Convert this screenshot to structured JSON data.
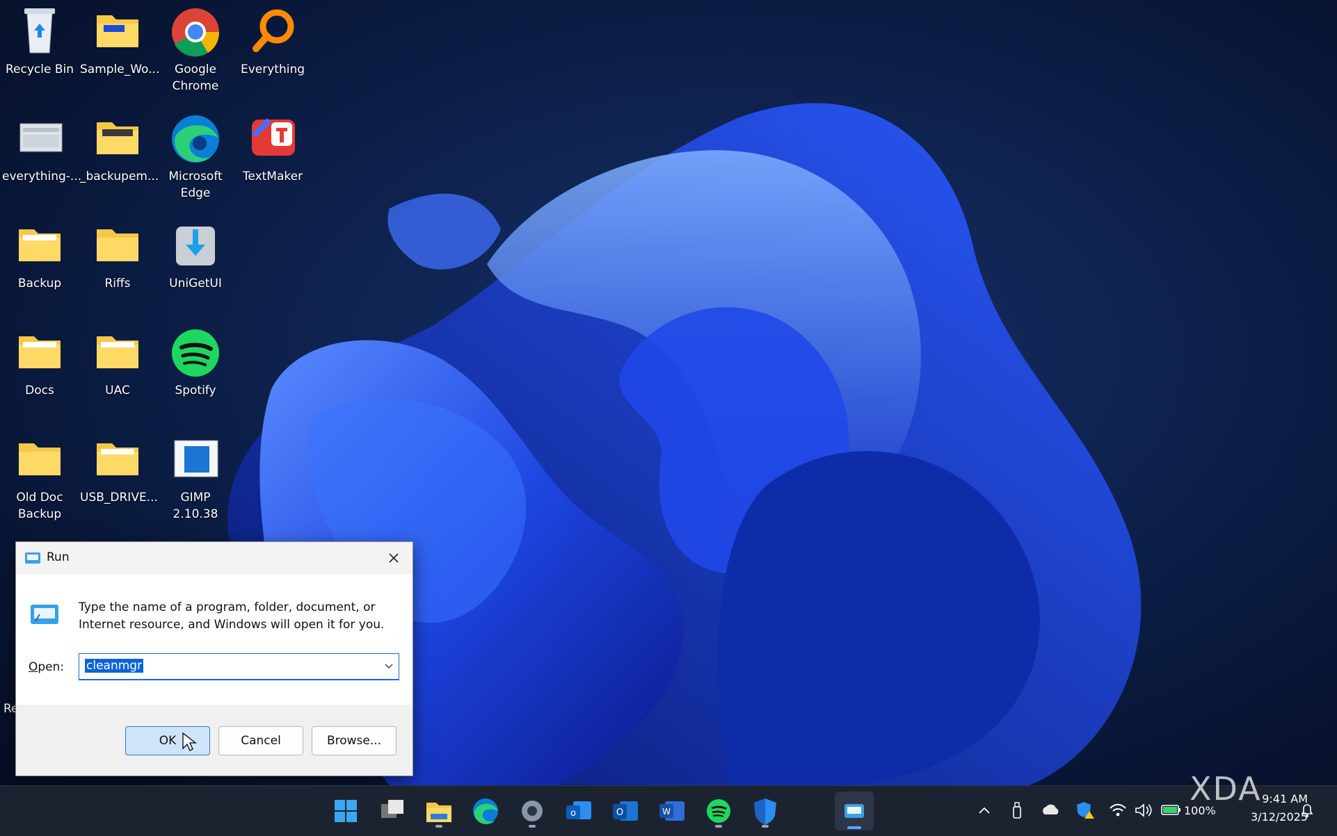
{
  "desktop": {
    "icons": [
      {
        "label": "Recycle Bin",
        "icon": "recycle-bin-icon"
      },
      {
        "label": "Sample_Wo...",
        "icon": "folder-icon"
      },
      {
        "label": "Google Chrome",
        "icon": "chrome-icon"
      },
      {
        "label": "Everything",
        "icon": "everything-search-icon"
      },
      {
        "label": "everything-...",
        "icon": "screenshot-file-icon"
      },
      {
        "label": "_backupem...",
        "icon": "folder-icon"
      },
      {
        "label": "Microsoft Edge",
        "icon": "edge-icon"
      },
      {
        "label": "TextMaker",
        "icon": "textmaker-icon"
      },
      {
        "label": "Backup",
        "icon": "folder-icon"
      },
      {
        "label": "Riffs",
        "icon": "folder-icon"
      },
      {
        "label": "UniGetUI",
        "icon": "unigetui-icon"
      },
      {
        "label": "Docs",
        "icon": "folder-icon"
      },
      {
        "label": "UAC",
        "icon": "folder-icon"
      },
      {
        "label": "Spotify",
        "icon": "spotify-icon"
      },
      {
        "label": "Old Doc Backup",
        "icon": "folder-icon"
      },
      {
        "label": "USB_DRIVE...",
        "icon": "folder-icon"
      },
      {
        "label": "GIMP 2.10.38",
        "icon": "gimp-icon"
      }
    ],
    "partial_label": "Re"
  },
  "run_dialog": {
    "title": "Run",
    "description": "Type the name of a program, folder, document, or Internet resource, and Windows will open it for you.",
    "open_label_pre": "",
    "open_label_accel": "O",
    "open_label_post": "pen:",
    "input_value": "cleanmgr",
    "ok_label": "OK",
    "cancel_label": "Cancel",
    "browse_label": "Browse..."
  },
  "taskbar": {
    "apps": [
      "start-icon",
      "task-view-icon",
      "file-explorer-icon",
      "edge-icon",
      "settings-icon",
      "outlook-new-icon",
      "outlook-classic-icon",
      "word-icon",
      "spotify-icon",
      "defender-icon",
      "run-app-icon"
    ],
    "tray": {
      "battery_percent": "100%",
      "time": "9:41 AM",
      "date": "3/12/2025"
    }
  },
  "watermark": "XDA",
  "colors": {
    "accent": "#1a68d6",
    "wallpaper_base": "#07142e",
    "taskbar": "#1c2330"
  }
}
